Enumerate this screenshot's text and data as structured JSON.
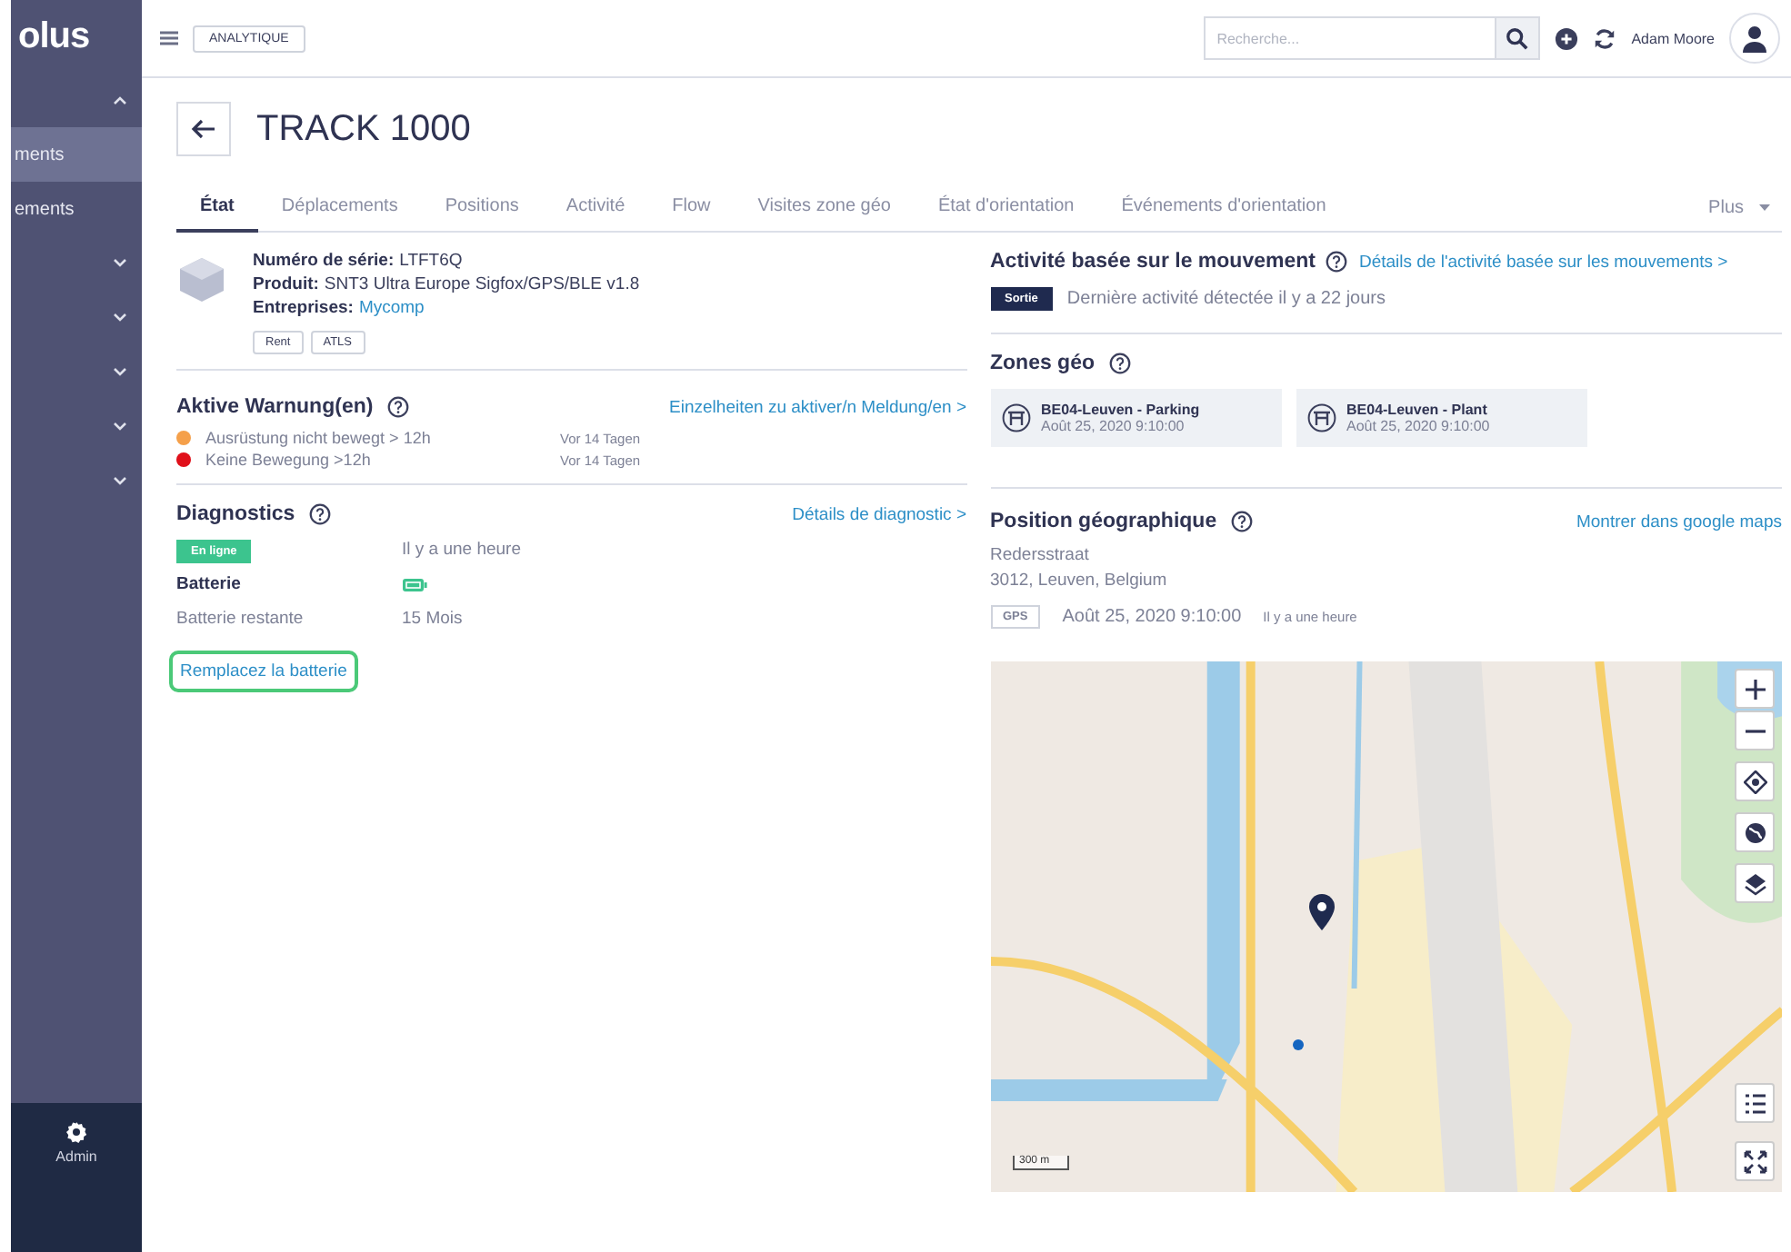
{
  "sidebar": {
    "logo": "olus",
    "items": [
      {
        "kind": "caret",
        "expanded": true
      },
      {
        "kind": "link",
        "label": "ments",
        "selected": true
      },
      {
        "kind": "link",
        "label": "ements",
        "selected": false
      },
      {
        "kind": "caret",
        "expanded": false
      },
      {
        "kind": "caret",
        "expanded": false
      },
      {
        "kind": "caret",
        "expanded": false
      },
      {
        "kind": "caret",
        "expanded": false
      },
      {
        "kind": "caret",
        "expanded": false
      }
    ],
    "admin": "Admin"
  },
  "topbar": {
    "module": "ANALYTIQUE",
    "search": {
      "placeholder": "Recherche..."
    },
    "user": "Adam Moore"
  },
  "header": {
    "title": "TRACK 1000"
  },
  "tabs": [
    {
      "label": "État",
      "selected": true
    },
    {
      "label": "Déplacements",
      "selected": false
    },
    {
      "label": "Positions",
      "selected": false
    },
    {
      "label": "Activité",
      "selected": false
    },
    {
      "label": "Flow",
      "selected": false
    },
    {
      "label": "Visites zone géo",
      "selected": false
    },
    {
      "label": "État d'orientation",
      "selected": false
    },
    {
      "label": "Événements d'orientation",
      "selected": false
    }
  ],
  "more": "Plus",
  "device": {
    "fields": [
      {
        "label": "Numéro de série:",
        "value": "LTFT6Q",
        "kind": "text"
      },
      {
        "label": "Produit:",
        "value": "SNT3 Ultra Europe Sigfox/GPS/BLE v1.8",
        "kind": "text"
      },
      {
        "label": "Entreprises:",
        "value": "Mycomp",
        "kind": "link"
      }
    ],
    "tags": [
      "Rent",
      "ATLS"
    ]
  },
  "warnings": {
    "title": "Aktive Warnung(en)",
    "link": "Einzelheiten zu aktiver/n Meldung/en >",
    "items": [
      {
        "text": "Ausrüstung nicht bewegt > 12h",
        "time": "Vor 14 Tagen",
        "color": "#f5a04a"
      },
      {
        "text": "Keine Bewegung >12h",
        "time": "Vor 14 Tagen",
        "color": "#e0101a"
      }
    ]
  },
  "diagnostics": {
    "title": "Diagnostics",
    "link": "Détails de diagnostic >",
    "status": {
      "label": "En ligne",
      "time": "Il y a une heure"
    },
    "battery": {
      "label": "Batterie"
    },
    "remaining": {
      "label": "Batterie restante",
      "value": "15 Mois"
    },
    "action": {
      "label": "Remplacez la batterie",
      "highlighted": true
    }
  },
  "activity": {
    "title": "Activité basée sur le mouvement",
    "link": "Détails de l'activité basée sur les mouvements >",
    "badge": "Sortie",
    "text": "Dernière activité détectée il y a 22 jours"
  },
  "zones": {
    "title": "Zones géo",
    "items": [
      {
        "name": "BE04-Leuven - Parking",
        "date": "Août 25, 2020 9:10:00"
      },
      {
        "name": "BE04-Leuven - Plant",
        "date": "Août 25, 2020 9:10:00"
      }
    ]
  },
  "position": {
    "title": "Position géographique",
    "link": "Montrer dans google maps",
    "address": [
      "Redersstraat",
      "3012, Leuven, Belgium"
    ],
    "source": "GPS",
    "date": "Août 25, 2020 9:10:00",
    "ago": "Il y a une heure",
    "map": {
      "scale": "300 m"
    }
  }
}
